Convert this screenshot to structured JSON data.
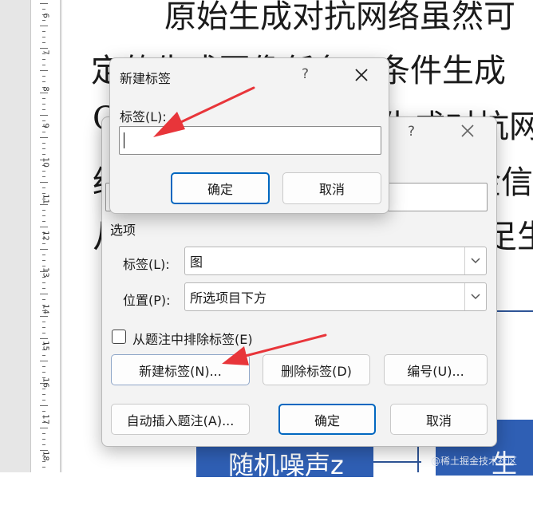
{
  "document": {
    "lines": [
      "原始生成对抗网络虽然可",
      "定的生成图像任务，条件生成",
      "C",
      "生成对抗网",
      "经",
      "金信",
      "从",
      "足生"
    ],
    "diagram_box_label": "随机噪声z",
    "diagram_box2_label": "生成",
    "watermark": "@稀土掘金技术社区"
  },
  "ruler": {
    "numbers": [
      "6",
      "7",
      "8",
      "9",
      "10",
      "11",
      "12",
      "13",
      "14",
      "15",
      "16",
      "17",
      "18"
    ]
  },
  "caption_dialog": {
    "help": "?",
    "close_glyph": "✕",
    "options_heading": "选项",
    "label_field": {
      "label": "标签(L):",
      "value": "图"
    },
    "position_field": {
      "label": "位置(P):",
      "value": "所选项目下方"
    },
    "exclude_label_checkbox": {
      "label": "从题注中排除标签(E)",
      "checked": false
    },
    "buttons": {
      "new_label": "新建标签(N)...",
      "delete_label": "删除标签(D)",
      "numbering": "编号(U)...",
      "auto_caption": "自动插入题注(A)...",
      "ok": "确定",
      "cancel": "取消"
    }
  },
  "new_label_dialog": {
    "title": "新建标签",
    "help": "?",
    "close_glyph": "✕",
    "label_caption": "标签(L):",
    "input_value": "",
    "buttons": {
      "ok": "确定",
      "cancel": "取消"
    }
  },
  "colors": {
    "annotation_arrow": "#e8353a",
    "primary_border": "#0067c0",
    "diagram_blue": "#2f5fb4"
  }
}
